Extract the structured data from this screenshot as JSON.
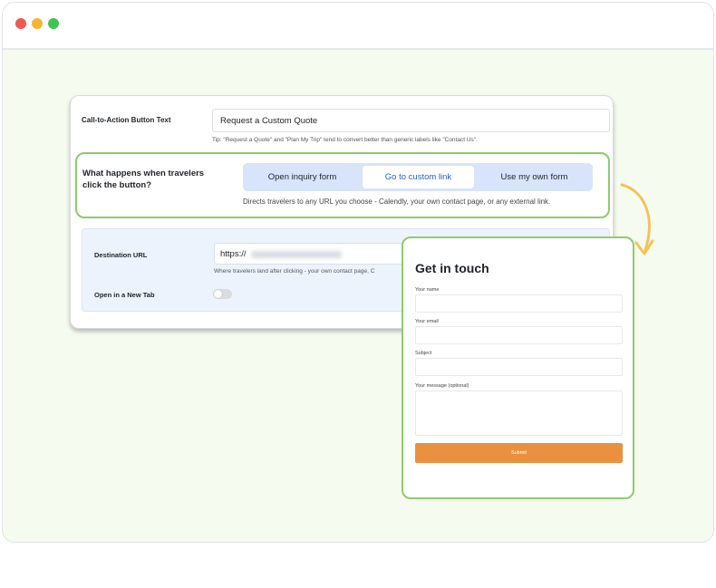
{
  "settings": {
    "cta_label": "Call-to-Action Button Text",
    "cta_value": "Request a Custom Quote",
    "tip": "Tip: \"Request a Quote\" and \"Plan My Trip\" tend to convert better than generic labels like \"Contact Us\".",
    "behavior_question": "What happens when travelers click the button?",
    "behavior_options": [
      "Open inquiry form",
      "Go to custom link",
      "Use my own form"
    ],
    "behavior_selected": "Go to custom link",
    "behavior_description": "Directs travelers to any URL you choose - Calendly, your own contact page, or any external link.",
    "destination_label": "Destination URL",
    "destination_prefix": "https://",
    "destination_help": "Where travelers land after clicking - your own contact page, C",
    "new_tab_label": "Open in a New Tab",
    "new_tab_enabled": false
  },
  "contact_form": {
    "title": "Get in touch",
    "name_label": "Your name",
    "email_label": "Your email",
    "subject_label": "Subject",
    "message_label": "Your message (optional)",
    "submit_label": "Submit"
  },
  "colors": {
    "highlight_border": "#8fcb6a",
    "segment_bg": "#d7e4fa",
    "selected_text": "#2463c8",
    "submit_bg": "#e9913f",
    "arrow": "#f2c35a"
  }
}
